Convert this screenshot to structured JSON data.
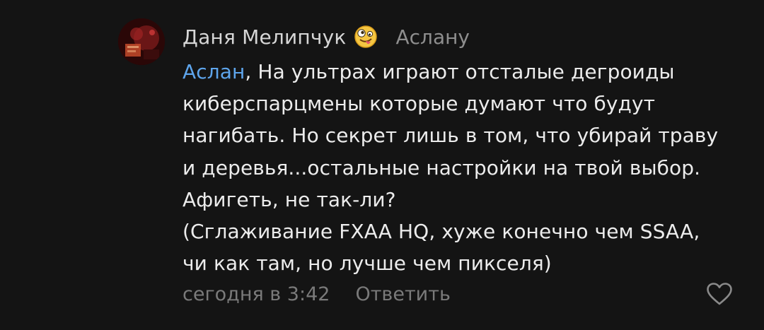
{
  "comment": {
    "author": "Даня Мелипчук",
    "author_emoji": "zany-face-emoji",
    "reply_to": "Аслану",
    "mention": "Аслан",
    "lines": [
      ", На ультрах играют отсталые дегроиды",
      "киберспарцмены которые думают что будут",
      "нагибать. Но секрет лишь в том, что убирай траву",
      "и деревья...остальные настройки на твой выбор.",
      "Афигеть, не так-ли?",
      "(Сглаживание FXAA HQ, хуже конечно чем SSAA,",
      "чи как там, но лучше чем пикселя)"
    ],
    "timestamp": "сегодня в 3:42",
    "reply_label": "Ответить",
    "like_icon": "heart-outline-icon"
  },
  "colors": {
    "background": "#141414",
    "mention": "#5ea5ec",
    "text": "#ececec",
    "secondary_text": "#7a7a7a"
  }
}
